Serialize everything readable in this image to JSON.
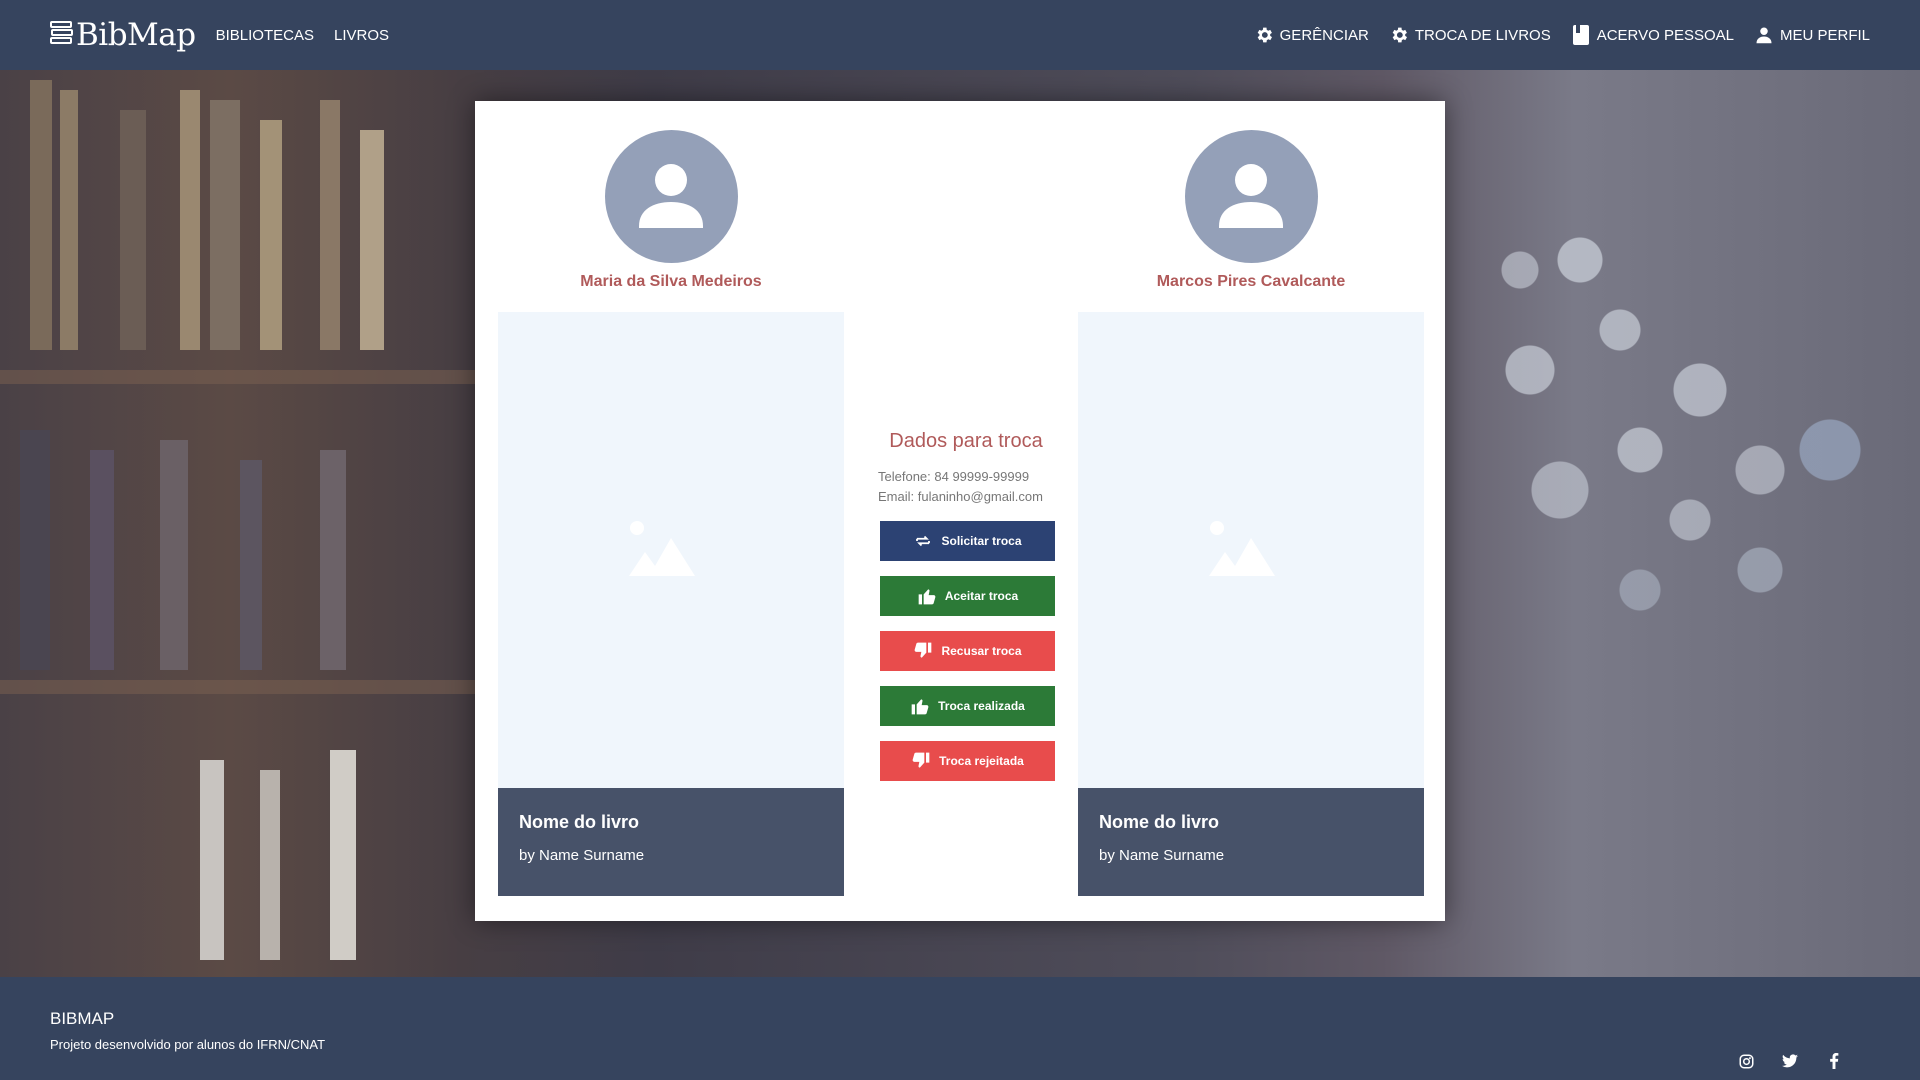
{
  "nav": {
    "logo": "BibMap",
    "left_links": [
      "BIBLIOTECAS",
      "LIVROS"
    ],
    "right_links": [
      {
        "label": "GERÊNCIAR",
        "icon": "gear-icon"
      },
      {
        "label": "TROCA DE LIVROS",
        "icon": "gear-icon"
      },
      {
        "label": "ACERVO PESSOAL",
        "icon": "book-icon"
      },
      {
        "label": "MEU PERFIL",
        "icon": "user-icon"
      }
    ]
  },
  "trade": {
    "left_user": {
      "name": "Maria da Silva Medeiros",
      "book_title": "Nome do livro",
      "book_author": "by Name Surname"
    },
    "right_user": {
      "name": "Marcos Pires Cavalcante",
      "book_title": "Nome do livro",
      "book_author": "by Name Surname"
    },
    "info": {
      "title": "Dados para troca",
      "phone": "Telefone: 84 99999-99999",
      "email": "Email: fulaninho@gmail.com"
    },
    "buttons": [
      {
        "label": "Solicitar troca",
        "color": "#2c4273",
        "icon": "swap-icon"
      },
      {
        "label": "Aceitar troca",
        "color": "#2c7a37",
        "icon": "thumbs-up-icon"
      },
      {
        "label": "Recusar troca",
        "color": "#e84c4c",
        "icon": "thumbs-down-icon"
      },
      {
        "label": "Troca realizada",
        "color": "#2c7a37",
        "icon": "thumbs-up-icon"
      },
      {
        "label": "Troca rejeitada",
        "color": "#e84c4c",
        "icon": "thumbs-down-icon"
      }
    ]
  },
  "footer": {
    "title": "BIBMAP",
    "subtitle": "Projeto desenvolvido por alunos do IFRN/CNAT",
    "social": [
      "instagram-icon",
      "twitter-icon",
      "facebook-icon"
    ]
  },
  "colors": {
    "nav_bg": "#36445e",
    "accent_name": "#b05a5a",
    "book_info_bg": "#475269",
    "avatar_bg": "#94a0b8"
  }
}
